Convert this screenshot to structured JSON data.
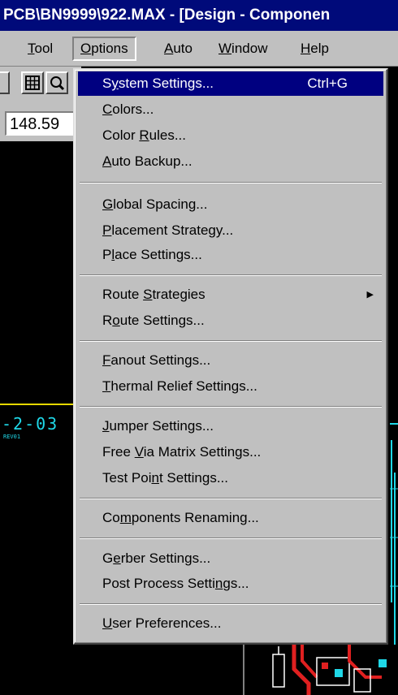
{
  "window": {
    "title": "PCB\\BN9999\\922.MAX - [Design - Componen"
  },
  "menubar": [
    {
      "label": "Tool",
      "key": "T",
      "rest": "ool"
    },
    {
      "label": "Options",
      "key": "O",
      "rest": "ptions"
    },
    {
      "label": "Auto",
      "key": "A",
      "rest": "uto"
    },
    {
      "label": "Window",
      "key": "W",
      "rest": "indow"
    },
    {
      "label": "Help",
      "key": "H",
      "rest": "elp"
    }
  ],
  "coordinate": "148.59",
  "canvas_text": {
    "label": "-2-03",
    "small": "REV01"
  },
  "menu": {
    "system_settings": {
      "pre": "S",
      "key": "y",
      "post": "stem Settings...",
      "shortcut": "Ctrl+G"
    },
    "colors": {
      "pre": "",
      "key": "C",
      "post": "olors..."
    },
    "color_rules": {
      "pre": "Color ",
      "key": "R",
      "post": "ules..."
    },
    "auto_backup": {
      "pre": "",
      "key": "A",
      "post": "uto Backup..."
    },
    "global_spacing": {
      "pre": "",
      "key": "G",
      "post": "lobal Spacing..."
    },
    "placement_strategy": {
      "pre": "",
      "key": "P",
      "post": "lacement Strategy..."
    },
    "place_settings": {
      "pre": "P",
      "key": "l",
      "post": "ace Settings..."
    },
    "route_strategies": {
      "pre": "Route ",
      "key": "S",
      "post": "trategies"
    },
    "route_settings": {
      "pre": "R",
      "key": "o",
      "post": "ute Settings..."
    },
    "fanout_settings": {
      "pre": "",
      "key": "F",
      "post": "anout Settings..."
    },
    "thermal_relief": {
      "pre": "",
      "key": "T",
      "post": "hermal Relief Settings..."
    },
    "jumper_settings": {
      "pre": "",
      "key": "J",
      "post": "umper Settings..."
    },
    "free_via_matrix": {
      "pre": "Free ",
      "key": "V",
      "post": "ia Matrix Settings..."
    },
    "test_point": {
      "pre": "Test Poi",
      "key": "n",
      "post": "t Settings..."
    },
    "components_renaming": {
      "pre": "Co",
      "key": "m",
      "post": "ponents Renaming..."
    },
    "gerber_settings": {
      "pre": "G",
      "key": "e",
      "post": "rber Settings..."
    },
    "post_process": {
      "pre": "Post Process Setti",
      "key": "n",
      "post": "gs..."
    },
    "user_preferences": {
      "pre": "",
      "key": "U",
      "post": "ser Preferences..."
    }
  },
  "colors": {
    "highlight": "#000080",
    "menu_bg": "#c0c0c0",
    "title_bg": "#000a7a",
    "pcb_cyan": "#1fd8e8",
    "pcb_red": "#e02020",
    "pcb_yellow": "#e6d800"
  }
}
